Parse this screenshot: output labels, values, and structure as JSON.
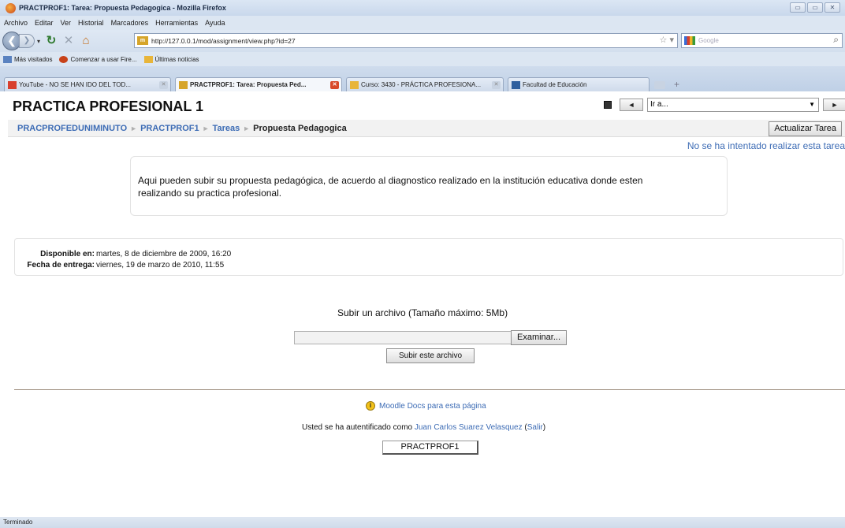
{
  "window": {
    "title": "PRACTPROF1: Tarea: Propuesta Pedagogica - Mozilla Firefox",
    "buttons": [
      "▭",
      "▭",
      "✕"
    ]
  },
  "menu": [
    "Archivo",
    "Editar",
    "Ver",
    "Historial",
    "Marcadores",
    "Herramientas",
    "Ayuda"
  ],
  "navigation": {
    "url": "http://127.0.0.1/mod/assignment/view.php?id=27",
    "search_placeholder": "Google"
  },
  "bookmarks": [
    "Más visitados",
    "Comenzar a usar Fire...",
    "Últimas noticias"
  ],
  "tabs": [
    {
      "label": "YouTube - NO SE HAN IDO DEL TOD...",
      "active": false
    },
    {
      "label": "PRACTPROF1: Tarea: Propuesta Ped...",
      "active": true
    },
    {
      "label": "Curso: 3430 - PRÁCTICA PROFESIONA...",
      "active": false
    },
    {
      "label": "Facultad de Educación",
      "active": false
    }
  ],
  "page": {
    "course_title": "PRACTICA PROFESIONAL 1",
    "jump_select": "Ir a...",
    "breadcrumb": [
      "PRACPROFEDUNIMINUTO",
      "PRACTPROF1",
      "Tareas",
      "Propuesta Pedagogica"
    ],
    "update_button": "Actualizar Tarea",
    "attempt_status": "No se ha intentado realizar esta tarea",
    "intro_line1": "Aqui pueden subir su propuesta pedagógica, de acuerdo al diagnostico realizado en la institución educativa donde esten",
    "intro_line2": "realizando su practica profesional.",
    "available_label": "Disponible en:",
    "available_value": "martes, 8 de diciembre de 2009, 16:20",
    "due_label": "Fecha de entrega:",
    "due_value": "viernes, 19 de marzo de 2010, 11:55",
    "upload_title": "Subir un archivo (Tamaño máximo: 5Mb)",
    "browse_button": "Examinar...",
    "upload_button": "Subir este archivo",
    "docs_link": "Moodle Docs para esta página",
    "login_prefix": "Usted se ha autentificado como ",
    "login_user": "Juan Carlos Suarez Velasquez",
    "login_open": " (",
    "logout_link": "Salir",
    "login_close": ")",
    "course_home_button": "PRACTPROF1"
  },
  "status_bar": "Terminado"
}
